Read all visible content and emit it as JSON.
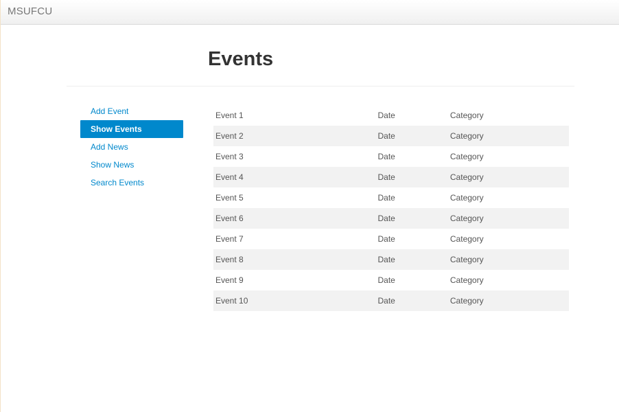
{
  "navbar": {
    "brand": "MSUFCU"
  },
  "page": {
    "title": "Events"
  },
  "sidebar": {
    "items": [
      {
        "label": "Add Event",
        "active": false
      },
      {
        "label": "Show Events",
        "active": true
      },
      {
        "label": "Add News",
        "active": false
      },
      {
        "label": "Show News",
        "active": false
      },
      {
        "label": "Search Events",
        "active": false
      }
    ]
  },
  "events": {
    "rows": [
      {
        "name": "Event 1",
        "date": "Date",
        "category": "Category"
      },
      {
        "name": "Event 2",
        "date": "Date",
        "category": "Category"
      },
      {
        "name": "Event 3",
        "date": "Date",
        "category": "Category"
      },
      {
        "name": "Event 4",
        "date": "Date",
        "category": "Category"
      },
      {
        "name": "Event 5",
        "date": "Date",
        "category": "Category"
      },
      {
        "name": "Event 6",
        "date": "Date",
        "category": "Category"
      },
      {
        "name": "Event 7",
        "date": "Date",
        "category": "Category"
      },
      {
        "name": "Event 8",
        "date": "Date",
        "category": "Category"
      },
      {
        "name": "Event 9",
        "date": "Date",
        "category": "Category"
      },
      {
        "name": "Event 10",
        "date": "Date",
        "category": "Category"
      }
    ]
  },
  "colors": {
    "link": "#0088cc",
    "active_bg": "#0088cc",
    "stripe": "#f2f2f2"
  }
}
